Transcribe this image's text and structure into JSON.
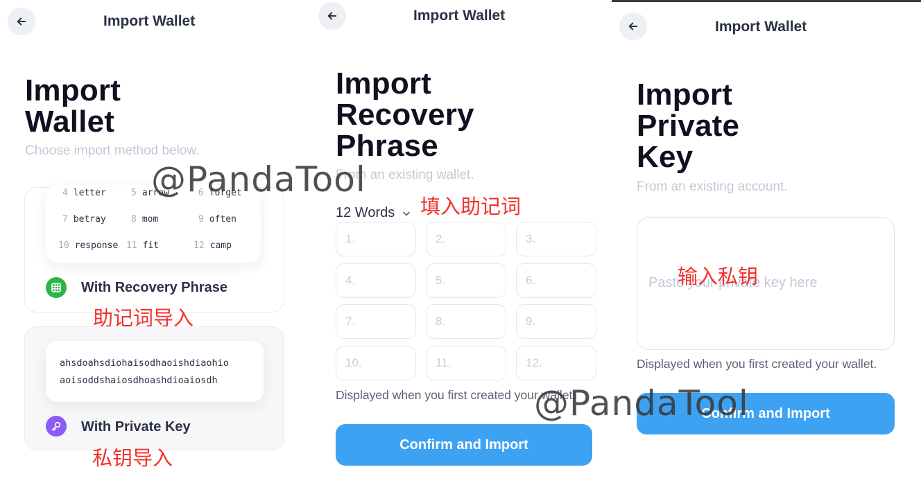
{
  "panel1": {
    "header_title": "Import Wallet",
    "title_line1": "Import",
    "title_line2": "Wallet",
    "subtitle": "Choose import method below.",
    "recovery_words": [
      {
        "n": "4",
        "w": "letter"
      },
      {
        "n": "5",
        "w": "arrow"
      },
      {
        "n": "6",
        "w": "forget"
      },
      {
        "n": "7",
        "w": "betray"
      },
      {
        "n": "8",
        "w": "mom"
      },
      {
        "n": "9",
        "w": "often"
      },
      {
        "n": "10",
        "w": "response"
      },
      {
        "n": "11",
        "w": "fit"
      },
      {
        "n": "12",
        "w": "camp"
      }
    ],
    "recovery_label": "With Recovery Phrase",
    "private_key_sample_line1": "ahsdoahsdiohaisodhaoishdiaohio",
    "private_key_sample_line2": "aoisoddshaiosdhoashdioaiosdh",
    "private_key_label": "With Private Key",
    "note_recovery": "助记词导入",
    "note_private_key": "私钥导入",
    "recovery_icon_color": "#2db34a",
    "private_key_icon_color": "#8b5cf6"
  },
  "panel2": {
    "header_title": "Import Wallet",
    "title_line1": "Import",
    "title_line2": "Recovery",
    "title_line3": "Phrase",
    "subtitle": "From an existing wallet.",
    "word_count": "12 Words",
    "note": "填入助记词",
    "placeholders": [
      "1.",
      "2.",
      "3.",
      "4.",
      "5.",
      "6.",
      "7.",
      "8.",
      "9.",
      "10.",
      "11.",
      "12."
    ],
    "hint": "Displayed when you first created your wallet.",
    "confirm_label": "Confirm and Import"
  },
  "panel3": {
    "header_title": "Import Wallet",
    "title_line1": "Import",
    "title_line2": "Private",
    "title_line3": "Key",
    "subtitle": "From an existing account.",
    "placeholder": "Paste your private key here",
    "note": "输入私钥",
    "hint": "Displayed when you first created your wallet.",
    "confirm_label": "Confirm and Import"
  },
  "watermark": "@PandaTool",
  "colors": {
    "accent": "#3ea2f3",
    "note_red": "#f2312c",
    "title": "#0f1020",
    "muted": "#c3c8d6"
  },
  "icons": [
    "back-arrow-icon",
    "grid-icon",
    "key-icon",
    "chevron-down-icon"
  ]
}
